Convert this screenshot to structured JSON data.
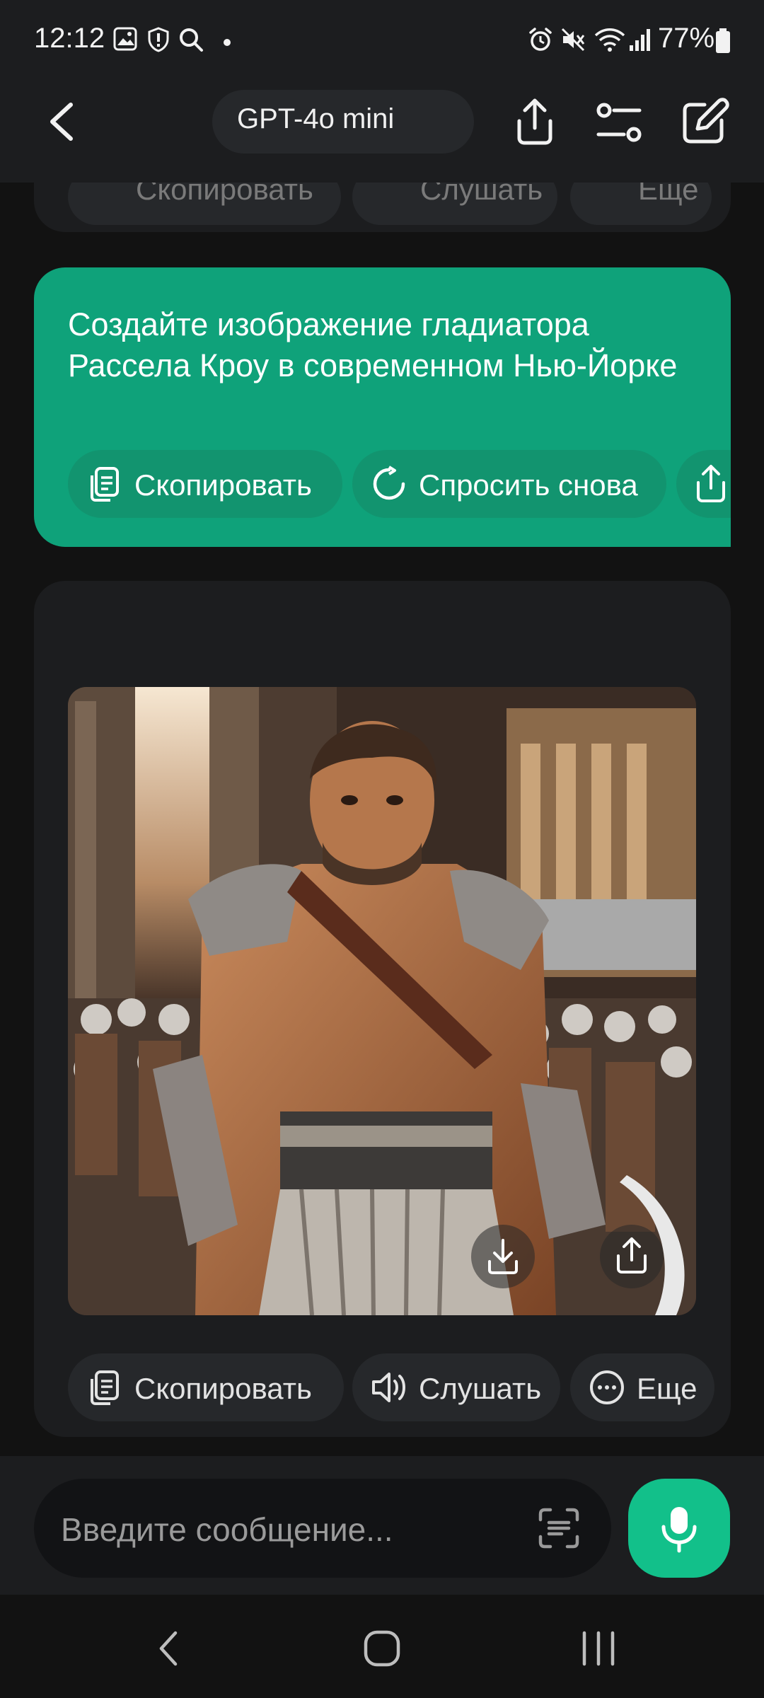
{
  "status_bar": {
    "time": "12:12",
    "battery": "77%",
    "icons": [
      "gallery-icon",
      "shield-icon",
      "search-icon",
      "dot-icon",
      "alarm-icon",
      "mute-icon",
      "wifi-icon",
      "signal-icon",
      "battery-icon"
    ]
  },
  "header": {
    "model_name": "GPT-4o mini",
    "icons": [
      "back-icon",
      "share-icon",
      "settings-sliders-icon",
      "edit-icon"
    ]
  },
  "previous_message_actions": [
    "Скопировать",
    "Слушать",
    "Еще"
  ],
  "user_message": {
    "text": "Создайте изображение гладиатора Рассела Кроу в современном Нью-Йорке",
    "actions": {
      "copy": "Скопировать",
      "ask_again": "Спросить снова"
    }
  },
  "bot_message": {
    "image_alt": "gladiator in modern New York street",
    "actions": {
      "copy": "Скопировать",
      "listen": "Слушать",
      "more": "Еще"
    }
  },
  "composer": {
    "placeholder": "Введите сообщение..."
  },
  "colors": {
    "accent": "#12c08a",
    "user_bubble": "#0fa27a",
    "background": "#121212",
    "card": "#1c1d1f"
  }
}
